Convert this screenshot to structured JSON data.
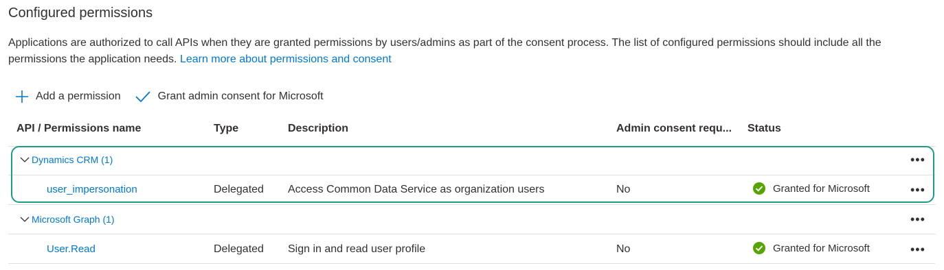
{
  "page": {
    "title": "Configured permissions",
    "intro_text": "Applications are authorized to call APIs when they are granted permissions by users/admins as part of the consent process. The list of configured permissions should include all the permissions the application needs.",
    "learn_more_link": "Learn more about permissions and consent"
  },
  "toolbar": {
    "add_permission": "Add a permission",
    "grant_consent": "Grant admin consent for Microsoft"
  },
  "table": {
    "columns": [
      "API / Permissions name",
      "Type",
      "Description",
      "Admin consent requ...",
      "Status"
    ],
    "groups": [
      {
        "name": "Dynamics CRM (1)",
        "permissions": [
          {
            "name": "user_impersonation",
            "type": "Delegated",
            "description": "Access Common Data Service as organization users",
            "admin_consent": "No",
            "status": "Granted for Microsoft"
          }
        ]
      },
      {
        "name": "Microsoft Graph (1)",
        "permissions": [
          {
            "name": "User.Read",
            "type": "Delegated",
            "description": "Sign in and read user profile",
            "admin_consent": "No",
            "status": "Granted for Microsoft"
          }
        ]
      }
    ],
    "more_label": "•••"
  },
  "colors": {
    "link": "#0078d4",
    "status_success": "#57a300",
    "highlight_border": "#1a9c85"
  },
  "icons": {
    "add": "plus-icon",
    "grant": "checkmark-icon",
    "group_toggle": "chevron-down-icon",
    "status": "check-circle-icon",
    "more": "more-horizontal-icon"
  }
}
